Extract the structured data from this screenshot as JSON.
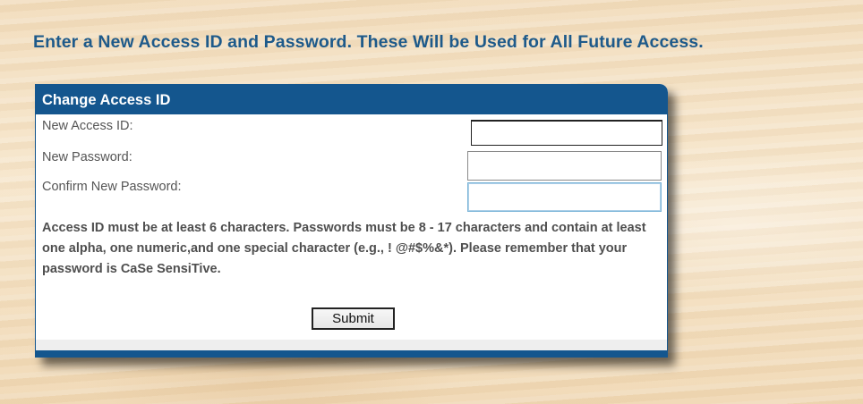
{
  "page": {
    "heading": "Enter a New Access ID and Password. These Will be Used for All Future Access."
  },
  "panel": {
    "title": "Change Access ID",
    "fields": {
      "access_id_label": "New Access ID:",
      "access_id_value": "",
      "password_label": "New Password:",
      "password_value": "",
      "confirm_label": "Confirm New Password:",
      "confirm_value": ""
    },
    "rules_text": "Access ID must be at least 6 characters. Passwords must be 8 - 17 characters and contain at least one alpha, one numeric,and one special character (e.g., ! @#$%&*). Please remember that your password is CaSe SensiTive.",
    "submit_label": "Submit"
  },
  "colors": {
    "heading_text": "#1e5a8a",
    "panel_header_bg": "#14568e",
    "background": "#f3dfc0"
  }
}
